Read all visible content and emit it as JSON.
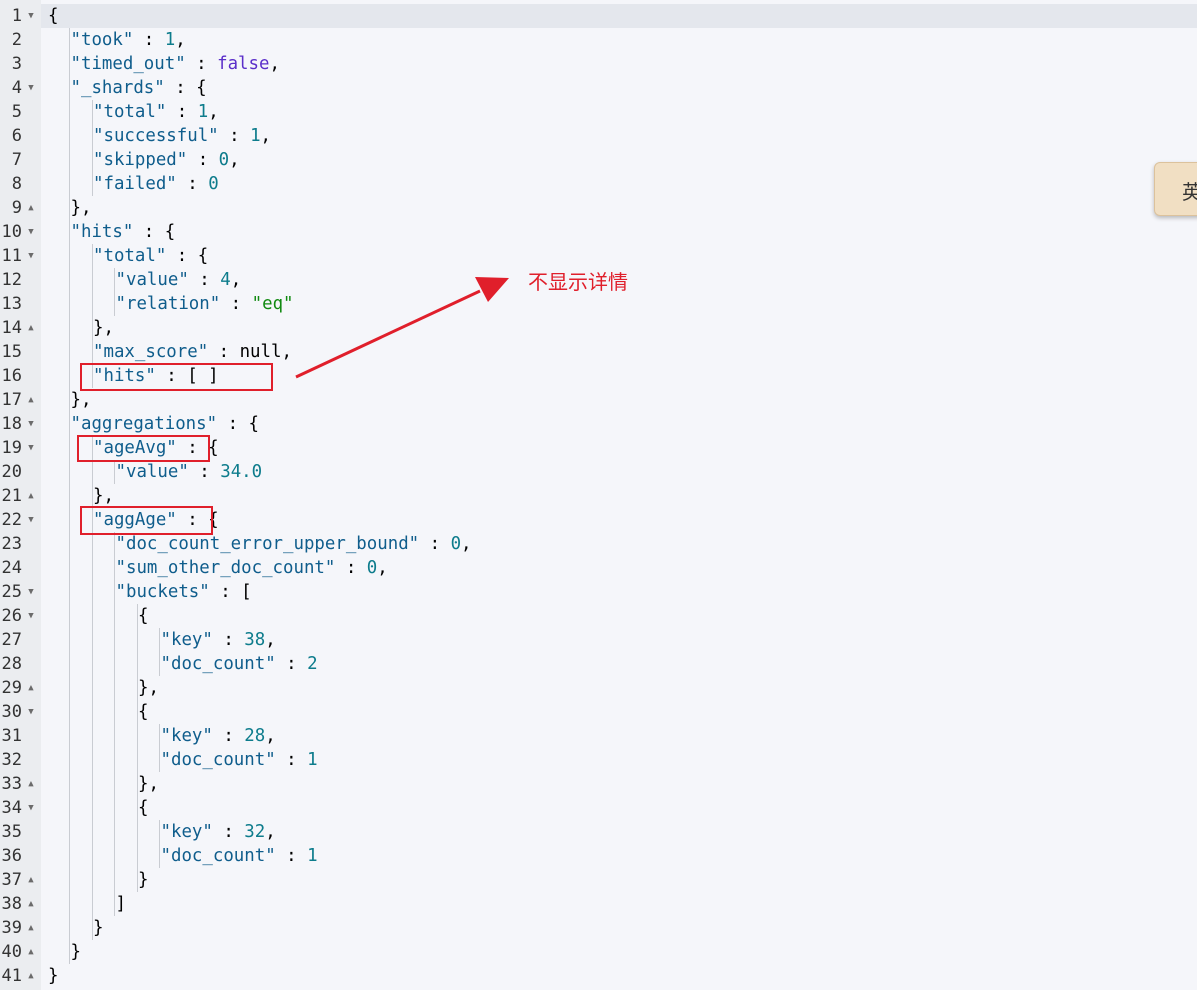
{
  "editor": {
    "lines": [
      {
        "n": "1",
        "fold": "open",
        "indent": 0,
        "tokens": [
          {
            "t": "{",
            "c": "p"
          }
        ]
      },
      {
        "n": "2",
        "fold": "",
        "indent": 1,
        "tokens": [
          {
            "t": "\"took\"",
            "c": "k"
          },
          {
            "t": " : ",
            "c": "p"
          },
          {
            "t": "1",
            "c": "n"
          },
          {
            "t": ",",
            "c": "p"
          }
        ]
      },
      {
        "n": "3",
        "fold": "",
        "indent": 1,
        "tokens": [
          {
            "t": "\"timed_out\"",
            "c": "k"
          },
          {
            "t": " : ",
            "c": "p"
          },
          {
            "t": "false",
            "c": "b"
          },
          {
            "t": ",",
            "c": "p"
          }
        ]
      },
      {
        "n": "4",
        "fold": "open",
        "indent": 1,
        "tokens": [
          {
            "t": "\"_shards\"",
            "c": "k"
          },
          {
            "t": " : {",
            "c": "p"
          }
        ]
      },
      {
        "n": "5",
        "fold": "",
        "indent": 2,
        "tokens": [
          {
            "t": "\"total\"",
            "c": "k"
          },
          {
            "t": " : ",
            "c": "p"
          },
          {
            "t": "1",
            "c": "n"
          },
          {
            "t": ",",
            "c": "p"
          }
        ]
      },
      {
        "n": "6",
        "fold": "",
        "indent": 2,
        "tokens": [
          {
            "t": "\"successful\"",
            "c": "k"
          },
          {
            "t": " : ",
            "c": "p"
          },
          {
            "t": "1",
            "c": "n"
          },
          {
            "t": ",",
            "c": "p"
          }
        ]
      },
      {
        "n": "7",
        "fold": "",
        "indent": 2,
        "tokens": [
          {
            "t": "\"skipped\"",
            "c": "k"
          },
          {
            "t": " : ",
            "c": "p"
          },
          {
            "t": "0",
            "c": "n"
          },
          {
            "t": ",",
            "c": "p"
          }
        ]
      },
      {
        "n": "8",
        "fold": "",
        "indent": 2,
        "tokens": [
          {
            "t": "\"failed\"",
            "c": "k"
          },
          {
            "t": " : ",
            "c": "p"
          },
          {
            "t": "0",
            "c": "n"
          }
        ]
      },
      {
        "n": "9",
        "fold": "close",
        "indent": 1,
        "tokens": [
          {
            "t": "},",
            "c": "p"
          }
        ]
      },
      {
        "n": "10",
        "fold": "open",
        "indent": 1,
        "tokens": [
          {
            "t": "\"hits\"",
            "c": "k"
          },
          {
            "t": " : {",
            "c": "p"
          }
        ]
      },
      {
        "n": "11",
        "fold": "open",
        "indent": 2,
        "tokens": [
          {
            "t": "\"total\"",
            "c": "k"
          },
          {
            "t": " : {",
            "c": "p"
          }
        ]
      },
      {
        "n": "12",
        "fold": "",
        "indent": 3,
        "tokens": [
          {
            "t": "\"value\"",
            "c": "k"
          },
          {
            "t": " : ",
            "c": "p"
          },
          {
            "t": "4",
            "c": "n"
          },
          {
            "t": ",",
            "c": "p"
          }
        ]
      },
      {
        "n": "13",
        "fold": "",
        "indent": 3,
        "tokens": [
          {
            "t": "\"relation\"",
            "c": "k"
          },
          {
            "t": " : ",
            "c": "p"
          },
          {
            "t": "\"eq\"",
            "c": "s"
          }
        ]
      },
      {
        "n": "14",
        "fold": "close",
        "indent": 2,
        "tokens": [
          {
            "t": "},",
            "c": "p"
          }
        ]
      },
      {
        "n": "15",
        "fold": "",
        "indent": 2,
        "tokens": [
          {
            "t": "\"max_score\"",
            "c": "k"
          },
          {
            "t": " : null,",
            "c": "p"
          }
        ]
      },
      {
        "n": "16",
        "fold": "",
        "indent": 2,
        "tokens": [
          {
            "t": "\"hits\"",
            "c": "k"
          },
          {
            "t": " : [ ]",
            "c": "p"
          }
        ]
      },
      {
        "n": "17",
        "fold": "close",
        "indent": 1,
        "tokens": [
          {
            "t": "},",
            "c": "p"
          }
        ]
      },
      {
        "n": "18",
        "fold": "open",
        "indent": 1,
        "tokens": [
          {
            "t": "\"aggregations\"",
            "c": "k"
          },
          {
            "t": " : {",
            "c": "p"
          }
        ]
      },
      {
        "n": "19",
        "fold": "open",
        "indent": 2,
        "tokens": [
          {
            "t": "\"ageAvg\"",
            "c": "k"
          },
          {
            "t": " : {",
            "c": "p"
          }
        ]
      },
      {
        "n": "20",
        "fold": "",
        "indent": 3,
        "tokens": [
          {
            "t": "\"value\"",
            "c": "k"
          },
          {
            "t": " : ",
            "c": "p"
          },
          {
            "t": "34.0",
            "c": "n"
          }
        ]
      },
      {
        "n": "21",
        "fold": "close",
        "indent": 2,
        "tokens": [
          {
            "t": "},",
            "c": "p"
          }
        ]
      },
      {
        "n": "22",
        "fold": "open",
        "indent": 2,
        "tokens": [
          {
            "t": "\"aggAge\"",
            "c": "k"
          },
          {
            "t": " : {",
            "c": "p"
          }
        ]
      },
      {
        "n": "23",
        "fold": "",
        "indent": 3,
        "tokens": [
          {
            "t": "\"doc_count_error_upper_bound\"",
            "c": "k"
          },
          {
            "t": " : ",
            "c": "p"
          },
          {
            "t": "0",
            "c": "n"
          },
          {
            "t": ",",
            "c": "p"
          }
        ]
      },
      {
        "n": "24",
        "fold": "",
        "indent": 3,
        "tokens": [
          {
            "t": "\"sum_other_doc_count\"",
            "c": "k"
          },
          {
            "t": " : ",
            "c": "p"
          },
          {
            "t": "0",
            "c": "n"
          },
          {
            "t": ",",
            "c": "p"
          }
        ]
      },
      {
        "n": "25",
        "fold": "open",
        "indent": 3,
        "tokens": [
          {
            "t": "\"buckets\"",
            "c": "k"
          },
          {
            "t": " : [",
            "c": "p"
          }
        ]
      },
      {
        "n": "26",
        "fold": "open",
        "indent": 4,
        "tokens": [
          {
            "t": "{",
            "c": "p"
          }
        ]
      },
      {
        "n": "27",
        "fold": "",
        "indent": 5,
        "tokens": [
          {
            "t": "\"key\"",
            "c": "k"
          },
          {
            "t": " : ",
            "c": "p"
          },
          {
            "t": "38",
            "c": "n"
          },
          {
            "t": ",",
            "c": "p"
          }
        ]
      },
      {
        "n": "28",
        "fold": "",
        "indent": 5,
        "tokens": [
          {
            "t": "\"doc_count\"",
            "c": "k"
          },
          {
            "t": " : ",
            "c": "p"
          },
          {
            "t": "2",
            "c": "n"
          }
        ]
      },
      {
        "n": "29",
        "fold": "close",
        "indent": 4,
        "tokens": [
          {
            "t": "},",
            "c": "p"
          }
        ]
      },
      {
        "n": "30",
        "fold": "open",
        "indent": 4,
        "tokens": [
          {
            "t": "{",
            "c": "p"
          }
        ]
      },
      {
        "n": "31",
        "fold": "",
        "indent": 5,
        "tokens": [
          {
            "t": "\"key\"",
            "c": "k"
          },
          {
            "t": " : ",
            "c": "p"
          },
          {
            "t": "28",
            "c": "n"
          },
          {
            "t": ",",
            "c": "p"
          }
        ]
      },
      {
        "n": "32",
        "fold": "",
        "indent": 5,
        "tokens": [
          {
            "t": "\"doc_count\"",
            "c": "k"
          },
          {
            "t": " : ",
            "c": "p"
          },
          {
            "t": "1",
            "c": "n"
          }
        ]
      },
      {
        "n": "33",
        "fold": "close",
        "indent": 4,
        "tokens": [
          {
            "t": "},",
            "c": "p"
          }
        ]
      },
      {
        "n": "34",
        "fold": "open",
        "indent": 4,
        "tokens": [
          {
            "t": "{",
            "c": "p"
          }
        ]
      },
      {
        "n": "35",
        "fold": "",
        "indent": 5,
        "tokens": [
          {
            "t": "\"key\"",
            "c": "k"
          },
          {
            "t": " : ",
            "c": "p"
          },
          {
            "t": "32",
            "c": "n"
          },
          {
            "t": ",",
            "c": "p"
          }
        ]
      },
      {
        "n": "36",
        "fold": "",
        "indent": 5,
        "tokens": [
          {
            "t": "\"doc_count\"",
            "c": "k"
          },
          {
            "t": " : ",
            "c": "p"
          },
          {
            "t": "1",
            "c": "n"
          }
        ]
      },
      {
        "n": "37",
        "fold": "close",
        "indent": 4,
        "tokens": [
          {
            "t": "}",
            "c": "p"
          }
        ]
      },
      {
        "n": "38",
        "fold": "close",
        "indent": 3,
        "tokens": [
          {
            "t": "]",
            "c": "p"
          }
        ]
      },
      {
        "n": "39",
        "fold": "close",
        "indent": 2,
        "tokens": [
          {
            "t": "}",
            "c": "p"
          }
        ]
      },
      {
        "n": "40",
        "fold": "close",
        "indent": 1,
        "tokens": [
          {
            "t": "}",
            "c": "p"
          }
        ]
      },
      {
        "n": "41",
        "fold": "close",
        "indent": 0,
        "tokens": [
          {
            "t": "}",
            "c": "p"
          }
        ]
      }
    ]
  },
  "annotation": {
    "text": "不显示详情",
    "color": "#e01f2b"
  },
  "ime": {
    "label": "英"
  },
  "colors": {
    "key": "#0f5d8c",
    "number": "#0d7c8c",
    "string": "#118a11",
    "boolean": "#5b2fc9"
  }
}
